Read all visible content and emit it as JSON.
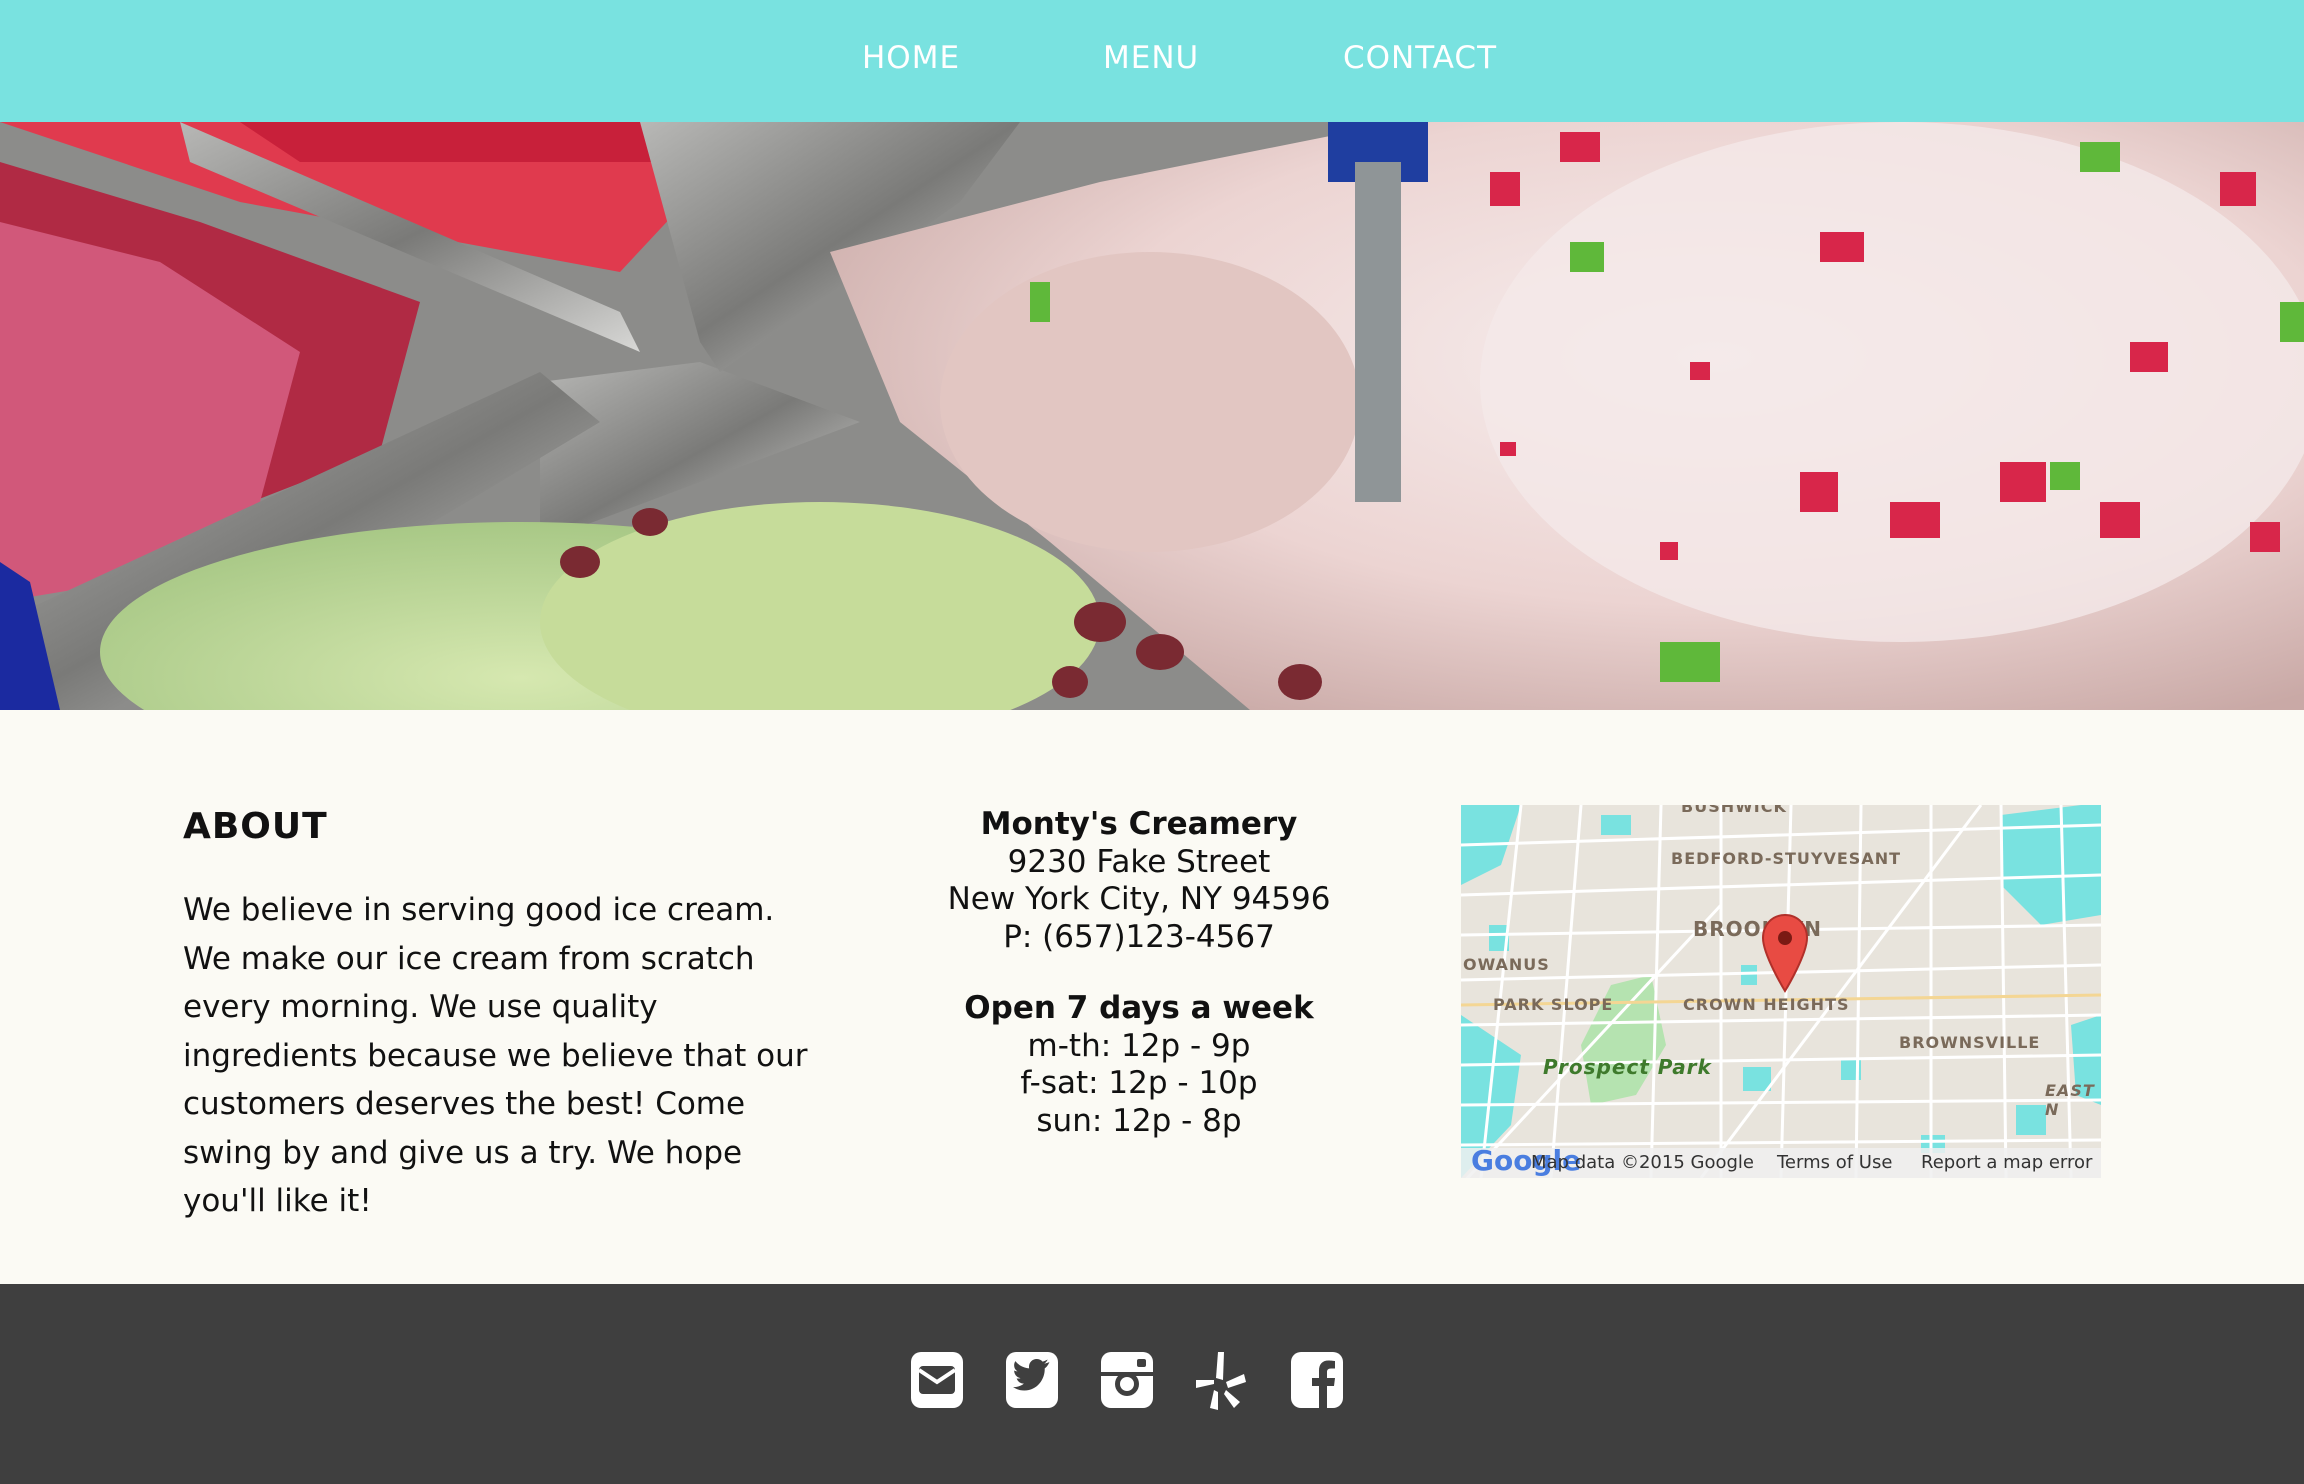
{
  "nav": {
    "items": [
      {
        "label": "HOME"
      },
      {
        "label": "MENU"
      },
      {
        "label": "CONTACT"
      }
    ]
  },
  "about": {
    "title": "ABOUT",
    "text": "We believe in serving good ice cream. We make our ice cream from scratch every morning. We use quality ingredients because we believe that our customers deserves the best! Come swing by and give us a try. We hope you'll like it!"
  },
  "contact": {
    "name": "Monty's Creamery",
    "street": "9230 Fake Street",
    "city": "New York City, NY 94596",
    "phone": "P: (657)123-4567",
    "hours_title": "Open 7 days a week",
    "hours": [
      "m-th: 12p - 9p",
      "f-sat: 12p - 10p",
      "sun: 12p - 8p"
    ]
  },
  "map": {
    "labels": {
      "bushwick": "BUSHWICK",
      "bedford": "BEDFORD-STUYVESANT",
      "brooklyn": "BROOKLYN",
      "gowanus": "OWANUS",
      "park_slope": "PARK SLOPE",
      "crown_heights": "CROWN HEIGHTS",
      "prospect_park": "Prospect Park",
      "brownsville": "BROWNSVILLE",
      "east_ny": "EAST N"
    },
    "google_logo": "Google",
    "map_data": "Map data ©2015 Google",
    "terms": "Terms of Use",
    "report": "Report a map error"
  },
  "footer": {
    "icons": [
      "email-icon",
      "twitter-icon",
      "instagram-icon",
      "yelp-icon",
      "facebook-icon"
    ]
  },
  "colors": {
    "nav_bg": "#79e2e0",
    "footer_bg": "#3f3f3f",
    "content_bg": "#fbfaf4"
  }
}
